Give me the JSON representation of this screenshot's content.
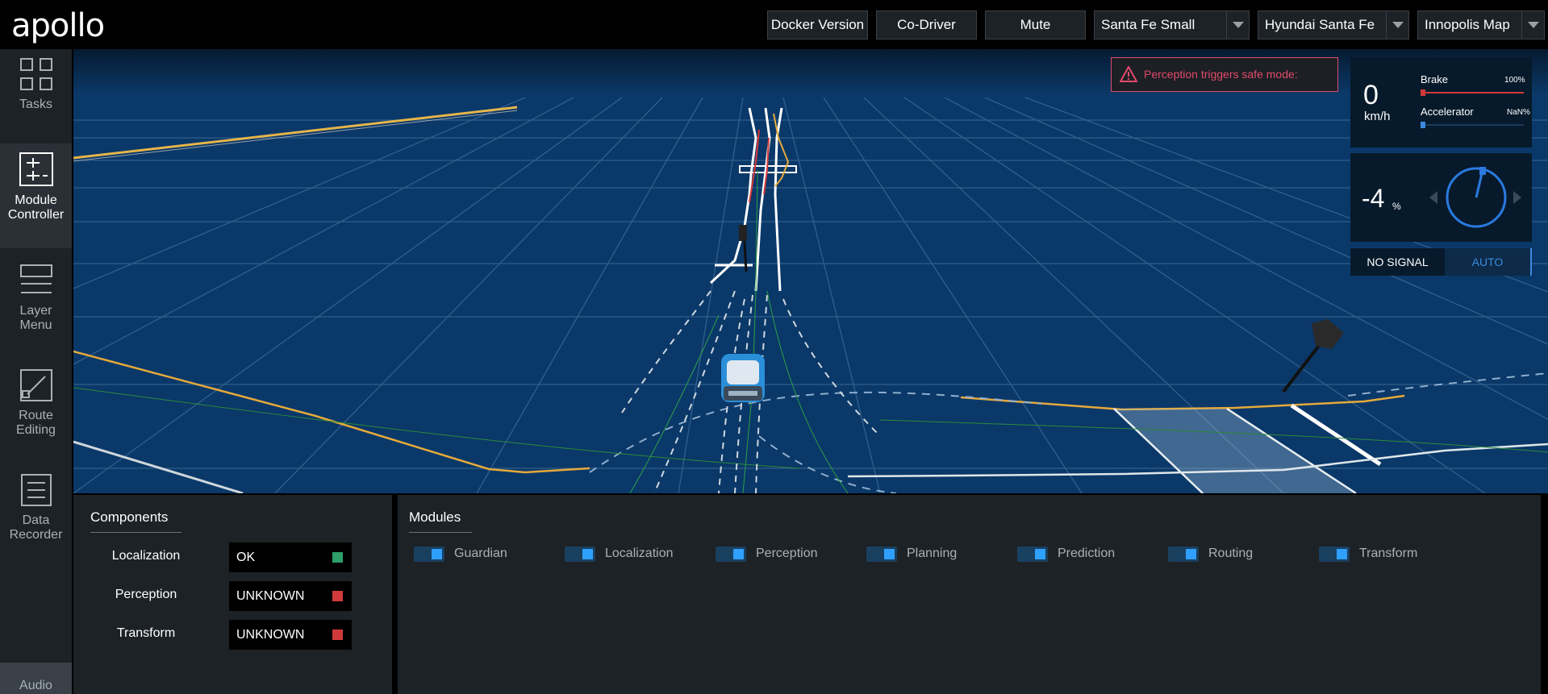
{
  "app": {
    "logo_text": "apollo"
  },
  "header": {
    "buttons": [
      {
        "label": "Docker Version"
      },
      {
        "label": "Co-Driver"
      },
      {
        "label": "Mute"
      }
    ],
    "selects": [
      {
        "value": "Santa Fe Small"
      },
      {
        "value": "Hyundai Santa Fe"
      },
      {
        "value": "Innopolis Map"
      }
    ]
  },
  "sidebar": {
    "items": [
      {
        "label": "Tasks",
        "icon": "tasks-icon"
      },
      {
        "label": "Module Controller",
        "icon": "module-controller-icon",
        "active": true
      },
      {
        "label": "Layer Menu",
        "icon": "layer-menu-icon"
      },
      {
        "label": "Route Editing",
        "icon": "route-editing-icon"
      },
      {
        "label": "Data Recorder",
        "icon": "data-recorder-icon"
      }
    ],
    "audio_label": "Audio"
  },
  "scene": {
    "alert_text": "Perception triggers safe mode:",
    "speed": {
      "value": "0",
      "unit": "km/h"
    },
    "brake": {
      "label": "Brake",
      "value_text": "100%",
      "level": 1.0
    },
    "accelerator": {
      "label": "Accelerator",
      "value_text": "NaN%",
      "level": 0.0
    },
    "steering": {
      "value": "-4",
      "unit": "%"
    },
    "signal_text": "NO SIGNAL",
    "drive_mode": "AUTO"
  },
  "components": {
    "title": "Components",
    "items": [
      {
        "label": "Localization",
        "status": "OK",
        "color": "#2e9e6a"
      },
      {
        "label": "Perception",
        "status": "UNKNOWN",
        "color": "#d03a3a"
      },
      {
        "label": "Transform",
        "status": "UNKNOWN",
        "color": "#d03a3a"
      }
    ]
  },
  "modules": {
    "title": "Modules",
    "items": [
      {
        "label": "Guardian",
        "on": true
      },
      {
        "label": "Localization",
        "on": true
      },
      {
        "label": "Perception",
        "on": true
      },
      {
        "label": "Planning",
        "on": true
      },
      {
        "label": "Prediction",
        "on": true
      },
      {
        "label": "Routing",
        "on": true
      },
      {
        "label": "Transform",
        "on": true
      }
    ]
  }
}
